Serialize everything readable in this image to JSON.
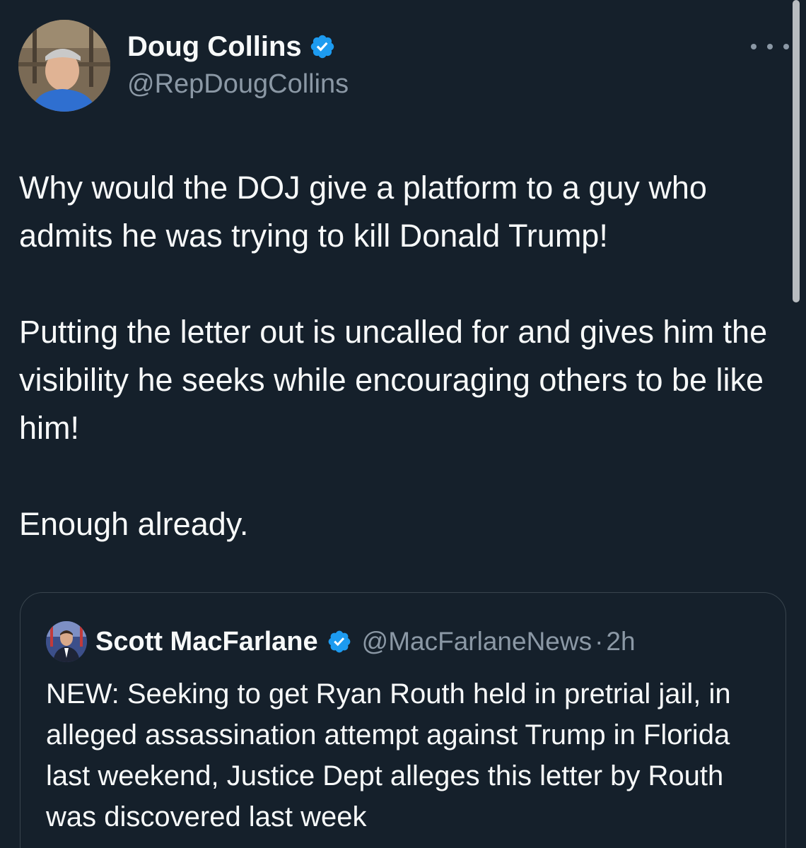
{
  "tweet": {
    "author_name": "Doug Collins",
    "author_handle": "@RepDougCollins",
    "paragraphs": [
      "Why would the DOJ give a platform to a guy who admits he was trying to kill Donald Trump!",
      "Putting the letter out is uncalled for and gives him the visibility he seeks while encouraging others to be like him!",
      "Enough already."
    ]
  },
  "quoted_tweet": {
    "author_name": "Scott MacFarlane",
    "author_handle": "@MacFarlaneNews",
    "separator": "·",
    "time": "2h",
    "text": "NEW:  Seeking to get Ryan Routh held in pretrial jail, in alleged assassination attempt against Trump in Florida last weekend, Justice Dept alleges this letter by Routh was discovered last week"
  },
  "icons": {
    "verified": "verified-badge-icon",
    "more": "more-options-icon"
  },
  "colors": {
    "background": "#15202b",
    "text": "#f7f9f9",
    "secondary_text": "#8b98a5",
    "verified_blue": "#1d9bf0",
    "border": "#38444d"
  }
}
